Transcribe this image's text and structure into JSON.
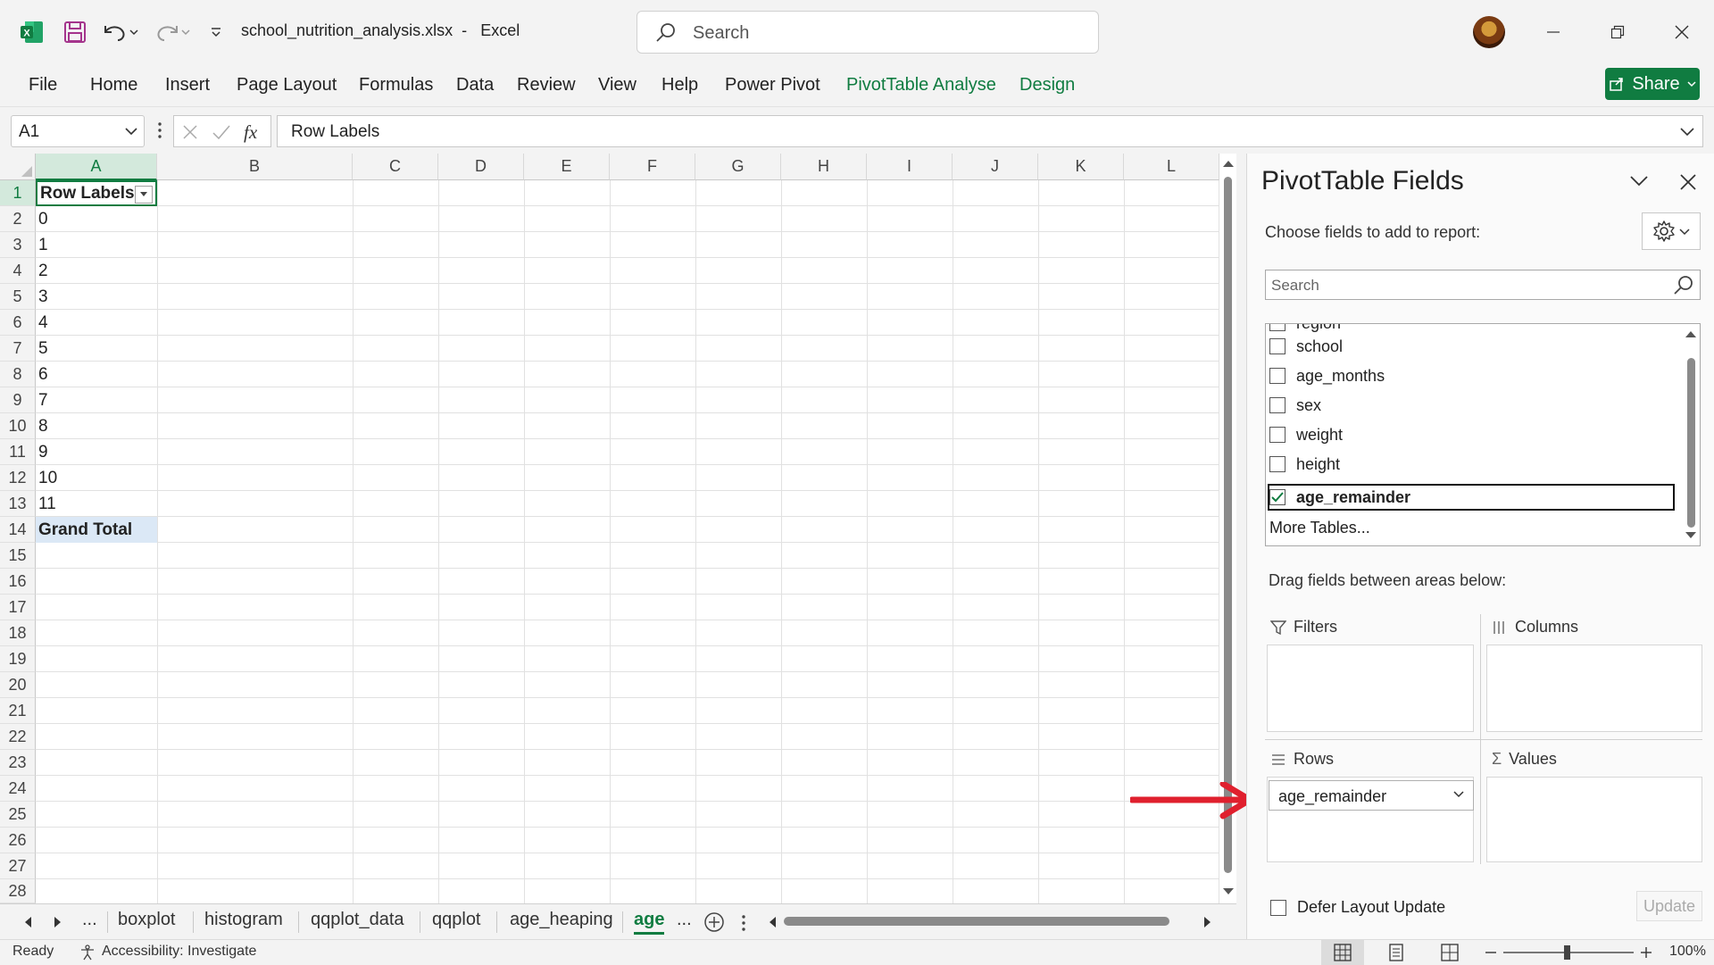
{
  "app": {
    "filename": "school_nutrition_analysis.xlsx",
    "separator": "-",
    "appname": "Excel",
    "search_placeholder": "Search"
  },
  "ribbon": {
    "tabs": [
      "File",
      "Home",
      "Insert",
      "Page Layout",
      "Formulas",
      "Data",
      "Review",
      "View",
      "Help",
      "Power Pivot",
      "PivotTable Analyse",
      "Design"
    ],
    "share_label": "Share"
  },
  "formula_bar": {
    "name_box": "A1",
    "formula": "Row Labels"
  },
  "grid": {
    "columns": [
      "A",
      "B",
      "C",
      "D",
      "E",
      "F",
      "G",
      "H",
      "I",
      "J",
      "K",
      "L"
    ],
    "rows": [
      "1",
      "2",
      "3",
      "4",
      "5",
      "6",
      "7",
      "8",
      "9",
      "10",
      "11",
      "12",
      "13",
      "14",
      "15",
      "16",
      "17",
      "18",
      "19",
      "20",
      "21",
      "22",
      "23",
      "24",
      "25",
      "26",
      "27",
      "28"
    ],
    "colA": [
      "Row Labels",
      "0",
      "1",
      "2",
      "3",
      "4",
      "5",
      "6",
      "7",
      "8",
      "9",
      "10",
      "11",
      "Grand Total"
    ]
  },
  "sheets": {
    "nav_more": "...",
    "tabs": [
      "boxplot",
      "histogram",
      "qqplot_data",
      "qqplot",
      "age_heaping"
    ],
    "active": "age",
    "active_more": "..."
  },
  "status": {
    "ready": "Ready",
    "accessibility": "Accessibility: Investigate",
    "zoom": "100%"
  },
  "pivot": {
    "title": "PivotTable Fields",
    "choose_label": "Choose fields to add to report:",
    "search_placeholder": "Search",
    "fields": [
      {
        "name": "region",
        "checked": false
      },
      {
        "name": "school",
        "checked": false
      },
      {
        "name": "age_months",
        "checked": false
      },
      {
        "name": "sex",
        "checked": false
      },
      {
        "name": "weight",
        "checked": false
      },
      {
        "name": "height",
        "checked": false
      },
      {
        "name": "age_remainder",
        "checked": true
      }
    ],
    "more_tables": "More Tables...",
    "drag_label": "Drag fields between areas below:",
    "areas": {
      "filters": "Filters",
      "columns": "Columns",
      "rows": "Rows",
      "values": "Values"
    },
    "rows_items": [
      "age_remainder"
    ],
    "defer_label": "Defer Layout Update",
    "update_label": "Update"
  },
  "colors": {
    "accent": "#107c41",
    "annotation_arrow": "#e0202e"
  }
}
